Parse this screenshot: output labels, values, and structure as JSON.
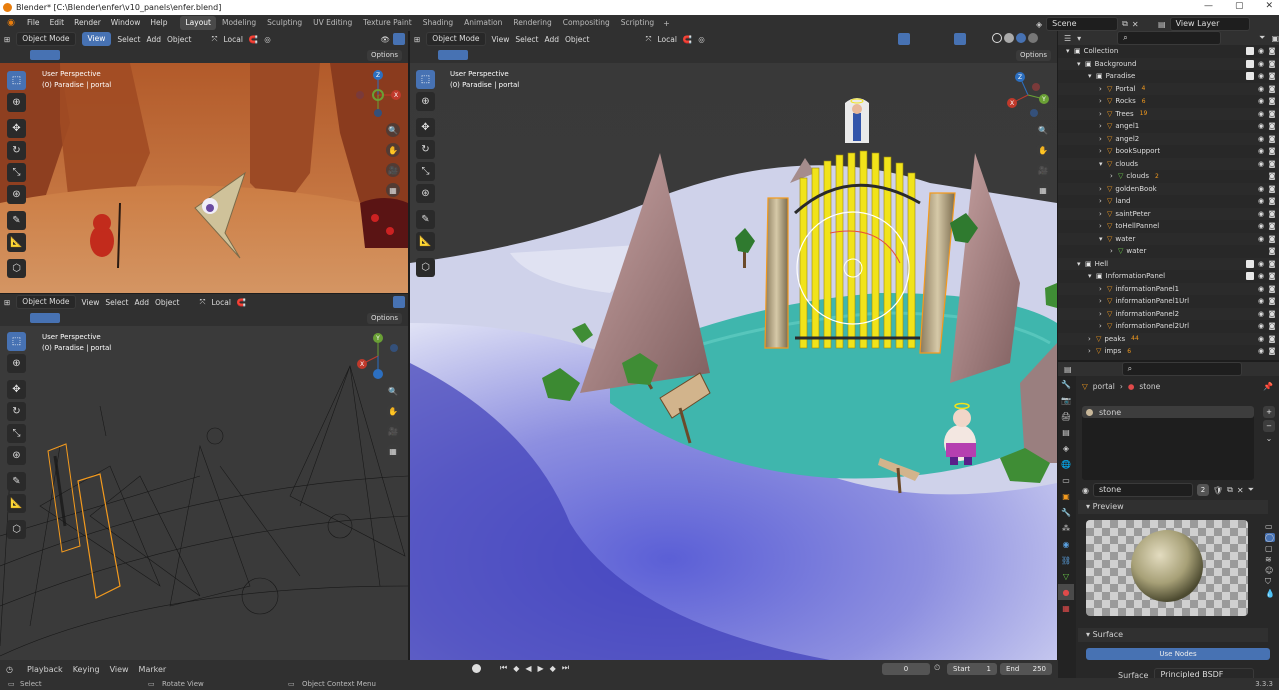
{
  "window": {
    "title": "Blender* [C:\\Blender\\enfer\\v10_panels\\enfer.blend]"
  },
  "menu": [
    "File",
    "Edit",
    "Render",
    "Window",
    "Help"
  ],
  "workspaces": [
    "Layout",
    "Modeling",
    "Sculpting",
    "UV Editing",
    "Texture Paint",
    "Shading",
    "Animation",
    "Rendering",
    "Compositing",
    "Scripting"
  ],
  "active_workspace": "Layout",
  "scene": "Scene",
  "view_layer": "View Layer",
  "viewport_tl": {
    "mode": "Object Mode",
    "menus": [
      "View",
      "Select",
      "Add",
      "Object"
    ],
    "pivot": "Local",
    "options": "Options",
    "perspective": "User Perspective",
    "context": "(0) Paradise | portal"
  },
  "viewport_bl": {
    "mode": "Object Mode",
    "menus": [
      "View",
      "Select",
      "Add",
      "Object"
    ],
    "pivot": "Local",
    "options": "Options",
    "perspective": "User Perspective",
    "context": "(0) Paradise | portal"
  },
  "viewport_main": {
    "mode": "Object Mode",
    "menus": [
      "View",
      "Select",
      "Add",
      "Object"
    ],
    "pivot": "Local",
    "options": "Options",
    "perspective": "User Perspective",
    "context": "(0) Paradise | portal"
  },
  "gizmo": {
    "x": "X",
    "y": "Y",
    "z": "Z"
  },
  "outliner": {
    "rows": [
      {
        "name": "Collection",
        "depth": 0,
        "type": "collection"
      },
      {
        "name": "Background",
        "depth": 1,
        "type": "collection"
      },
      {
        "name": "Paradise",
        "depth": 2,
        "type": "collection"
      },
      {
        "name": "Portal",
        "depth": 3,
        "type": "object",
        "badge": "4"
      },
      {
        "name": "Rocks",
        "depth": 3,
        "type": "object",
        "badge": "6"
      },
      {
        "name": "Trees",
        "depth": 3,
        "type": "object",
        "badge": "19"
      },
      {
        "name": "angel1",
        "depth": 3,
        "type": "mesh"
      },
      {
        "name": "angel2",
        "depth": 3,
        "type": "mesh"
      },
      {
        "name": "bookSupport",
        "depth": 3,
        "type": "mesh"
      },
      {
        "name": "clouds",
        "depth": 3,
        "type": "mesh"
      },
      {
        "name": "clouds",
        "depth": 4,
        "type": "data",
        "badge": "2"
      },
      {
        "name": "goldenBook",
        "depth": 3,
        "type": "mesh"
      },
      {
        "name": "land",
        "depth": 3,
        "type": "mesh"
      },
      {
        "name": "saintPeter",
        "depth": 3,
        "type": "mesh"
      },
      {
        "name": "toHellPannel",
        "depth": 3,
        "type": "mesh"
      },
      {
        "name": "water",
        "depth": 3,
        "type": "mesh"
      },
      {
        "name": "water",
        "depth": 4,
        "type": "data"
      },
      {
        "name": "Hell",
        "depth": 1,
        "type": "collection"
      },
      {
        "name": "InformationPanel",
        "depth": 2,
        "type": "collection"
      },
      {
        "name": "informationPanel1",
        "depth": 3,
        "type": "mesh"
      },
      {
        "name": "informationPanel1Url",
        "depth": 3,
        "type": "mesh"
      },
      {
        "name": "informationPanel2",
        "depth": 3,
        "type": "mesh"
      },
      {
        "name": "informationPanel2Url",
        "depth": 3,
        "type": "mesh"
      },
      {
        "name": "peaks",
        "depth": 2,
        "type": "object",
        "badge": "44"
      },
      {
        "name": "imps",
        "depth": 2,
        "type": "object",
        "badge": "6"
      }
    ]
  },
  "properties": {
    "breadcrumb_object": "portal",
    "breadcrumb_material": "stone",
    "slot": "stone",
    "material_name": "stone",
    "users": "2",
    "preview_label": "Preview",
    "surface_label": "Surface",
    "use_nodes": "Use Nodes",
    "surface_field_label": "Surface",
    "surface_value": "Principled BSDF"
  },
  "timeline": {
    "menus": [
      "Playback",
      "Keying",
      "View",
      "Marker"
    ],
    "current_frame": "0",
    "start_label": "Start",
    "start": "1",
    "end_label": "End",
    "end": "250"
  },
  "status": {
    "select": "Select",
    "rotate": "Rotate View",
    "context": "Object Context Menu",
    "version": "3.3.3"
  }
}
